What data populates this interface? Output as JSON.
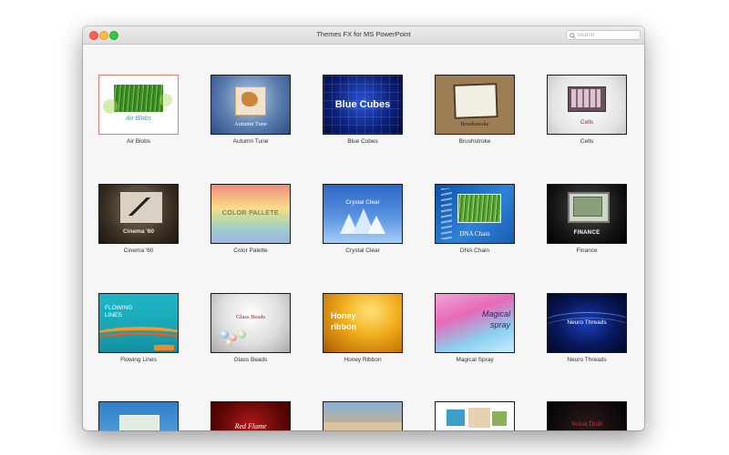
{
  "window": {
    "title": "Themes FX for MS PowerPoint",
    "search_placeholder": "Search"
  },
  "themes": [
    {
      "label": "Air Blobs",
      "thumb_text": "Air Blobs",
      "selected": true
    },
    {
      "label": "Autumn Tune",
      "thumb_text": "Autumn Tune"
    },
    {
      "label": "Blue Cubes",
      "thumb_text": "Blue Cubes"
    },
    {
      "label": "Brushstroke",
      "thumb_text": "Brushstroke"
    },
    {
      "label": "Cells",
      "thumb_text": "Cells"
    },
    {
      "label": "Cinema '60",
      "thumb_text": "Cinema '60"
    },
    {
      "label": "Color Palette",
      "thumb_text": "COLOR PALLETE"
    },
    {
      "label": "Crystal Clear",
      "thumb_text": "Crystal Clear"
    },
    {
      "label": "DNA Chain",
      "thumb_text": "DNA Chain"
    },
    {
      "label": "Finance",
      "thumb_text": "FINANCE"
    },
    {
      "label": "Flowing Lines",
      "thumb_text": "FLOWING LINES"
    },
    {
      "label": "Glass Beads",
      "thumb_text": "Glass Beads"
    },
    {
      "label": "Honey Ribbon",
      "thumb_text": "Honey ribbon"
    },
    {
      "label": "Magical Spray",
      "thumb_text": "Magical spray"
    },
    {
      "label": "Neuro Threads",
      "thumb_text": "Neuro Threads"
    },
    {
      "label": "",
      "thumb_text": ""
    },
    {
      "label": "",
      "thumb_text": "Red Flame"
    },
    {
      "label": "",
      "thumb_text": ""
    },
    {
      "label": "",
      "thumb_text": ""
    },
    {
      "label": "",
      "thumb_text": "Velvet Draft"
    }
  ]
}
